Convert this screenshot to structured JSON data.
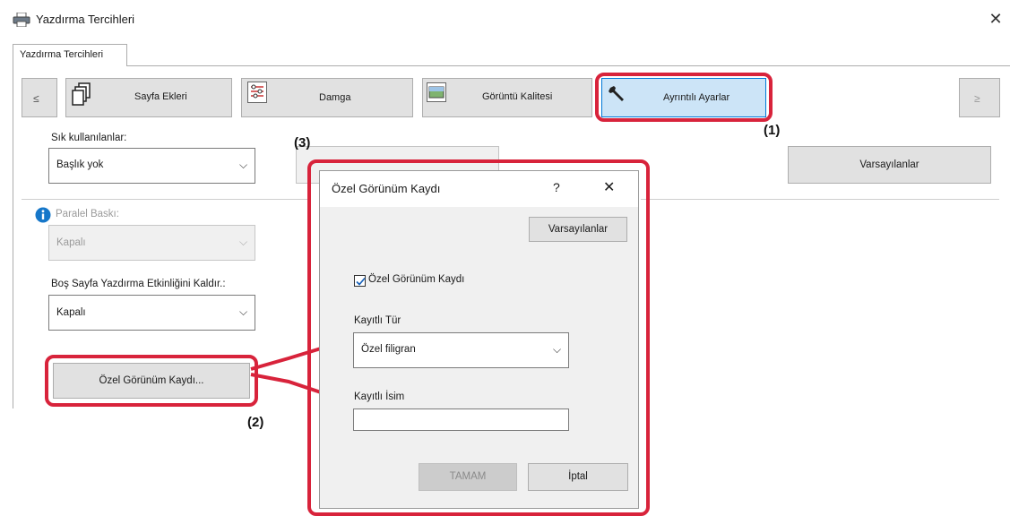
{
  "window": {
    "title": "Yazdırma Tercihleri",
    "tab": "Yazdırma Tercihleri"
  },
  "nav": {
    "prev": "≤",
    "next": "≥",
    "buttons": [
      {
        "label": "Sayfa Ekleri",
        "icon": "document-stack-icon"
      },
      {
        "label": "Damga",
        "icon": "stamp-icon"
      },
      {
        "label": "Görüntü Kalitesi",
        "icon": "image-quality-icon"
      },
      {
        "label": "Ayrıntılı Ayarlar",
        "icon": "wrench-icon"
      }
    ]
  },
  "main": {
    "favorites_label": "Sık kullanılanlar:",
    "favorites_value": "Başlık yok",
    "defaults_button": "Varsayılanlar",
    "parallel_label": "Paralel Baskı:",
    "parallel_value": "Kapalı",
    "blank_label": "Boş Sayfa Yazdırma Etkinliğini Kaldır.:",
    "blank_value": "Kapalı",
    "custom_view_button": "Özel Görünüm Kaydı..."
  },
  "dialog": {
    "title": "Özel Görünüm Kaydı",
    "help": "?",
    "close": "✕",
    "defaults_button": "Varsayılanlar",
    "checkbox_label": "Özel Görünüm Kaydı",
    "checkbox_checked": true,
    "type_label": "Kayıtlı Tür",
    "type_value": "Özel filigran",
    "name_label": "Kayıtlı İsim",
    "name_value": "",
    "ok_button": "TAMAM",
    "cancel_button": "İptal"
  },
  "annotations": {
    "one": "(1)",
    "two": "(2)",
    "three": "(3)",
    "accent": "#d8233b"
  }
}
